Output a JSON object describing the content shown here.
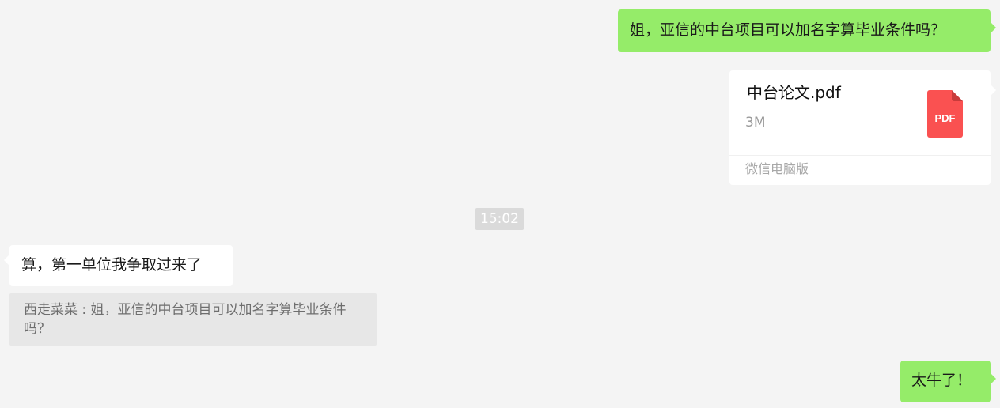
{
  "chat": {
    "outgoing_1": {
      "text": "姐，亚信的中台项目可以加名字算毕业条件吗？"
    },
    "file_card": {
      "name": "中台论文.pdf",
      "size": "3M",
      "source": "微信电脑版",
      "icon": "pdf-file-icon",
      "icon_label": "PDF",
      "icon_color": "#fa5151"
    },
    "timestamp": "15:02",
    "incoming_1": {
      "text": "算，第一单位我争取过来了"
    },
    "quote": {
      "sender": "西走菜菜",
      "separator": " : ",
      "text": "姐，亚信的中台项目可以加名字算毕业条件吗？"
    },
    "outgoing_2": {
      "text": "太牛了！"
    }
  },
  "colors": {
    "background": "#f4f4f4",
    "outgoing_bubble": "#95ec69",
    "incoming_bubble": "#ffffff",
    "quote_background": "#e7e7e7",
    "timestamp_background": "#dadada"
  }
}
